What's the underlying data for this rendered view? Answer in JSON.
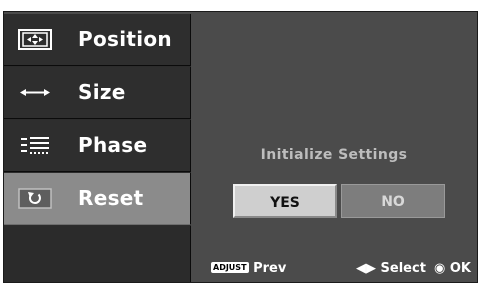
{
  "menu": {
    "items": [
      {
        "label": "Position",
        "icon": "position-icon",
        "selected": false
      },
      {
        "label": "Size",
        "icon": "size-icon",
        "selected": false
      },
      {
        "label": "Phase",
        "icon": "phase-icon",
        "selected": false
      },
      {
        "label": "Reset",
        "icon": "reset-icon",
        "selected": true
      }
    ]
  },
  "dialog": {
    "prompt": "Initialize Settings",
    "yes_label": "YES",
    "no_label": "NO"
  },
  "footer": {
    "adjust_badge": "ADJUST",
    "prev_label": "Prev",
    "select_label": "Select",
    "ok_label": "OK"
  },
  "colors": {
    "panel_bg": "#4b4b4b",
    "menu_bg": "#2e2e2e",
    "selected_bg": "#8b8b8b",
    "yes_bg": "#cfcfcf",
    "no_bg": "#7d7d7d"
  }
}
